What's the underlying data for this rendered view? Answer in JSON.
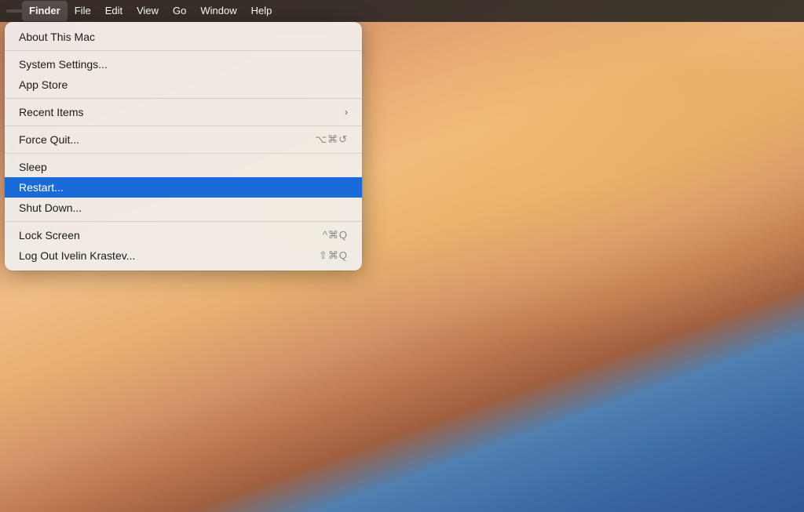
{
  "wallpaper": {
    "description": "macOS Sonoma desert dunes wallpaper"
  },
  "menubar": {
    "apple_logo": "",
    "items": [
      {
        "id": "finder",
        "label": "Finder",
        "bold": true,
        "active": true
      },
      {
        "id": "file",
        "label": "File",
        "bold": false
      },
      {
        "id": "edit",
        "label": "Edit",
        "bold": false
      },
      {
        "id": "view",
        "label": "View",
        "bold": false
      },
      {
        "id": "go",
        "label": "Go",
        "bold": false
      },
      {
        "id": "window",
        "label": "Window",
        "bold": false
      },
      {
        "id": "help",
        "label": "Help",
        "bold": false
      }
    ]
  },
  "dropdown": {
    "items": [
      {
        "id": "about",
        "label": "About This Mac",
        "shortcut": "",
        "chevron": false,
        "separator_after": true,
        "highlighted": false
      },
      {
        "id": "system-settings",
        "label": "System Settings...",
        "shortcut": "",
        "chevron": false,
        "separator_after": false,
        "highlighted": false
      },
      {
        "id": "app-store",
        "label": "App Store",
        "shortcut": "",
        "chevron": false,
        "separator_after": true,
        "highlighted": false
      },
      {
        "id": "recent-items",
        "label": "Recent Items",
        "shortcut": "",
        "chevron": true,
        "separator_after": true,
        "highlighted": false
      },
      {
        "id": "force-quit",
        "label": "Force Quit...",
        "shortcut": "⌥⌘↺",
        "chevron": false,
        "separator_after": true,
        "highlighted": false
      },
      {
        "id": "sleep",
        "label": "Sleep",
        "shortcut": "",
        "chevron": false,
        "separator_after": false,
        "highlighted": false
      },
      {
        "id": "restart",
        "label": "Restart...",
        "shortcut": "",
        "chevron": false,
        "separator_after": false,
        "highlighted": true
      },
      {
        "id": "shut-down",
        "label": "Shut Down...",
        "shortcut": "",
        "chevron": false,
        "separator_after": true,
        "highlighted": false
      },
      {
        "id": "lock-screen",
        "label": "Lock Screen",
        "shortcut": "^⌘Q",
        "chevron": false,
        "separator_after": false,
        "highlighted": false
      },
      {
        "id": "log-out",
        "label": "Log Out Ivelin Krastev...",
        "shortcut": "⇧⌘Q",
        "chevron": false,
        "separator_after": false,
        "highlighted": false
      }
    ]
  },
  "icons": {
    "chevron_right": "›",
    "apple": ""
  }
}
